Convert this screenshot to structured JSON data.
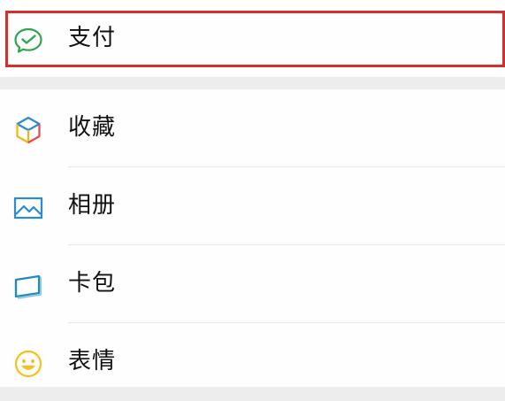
{
  "pay_section": {
    "item": {
      "label": "支付",
      "icon": "wechat-pay-icon"
    },
    "highlight_color": "#d32f2f"
  },
  "main_section": {
    "items": [
      {
        "label": "收藏",
        "icon": "favorites-cube-icon"
      },
      {
        "label": "相册",
        "icon": "album-picture-icon"
      },
      {
        "label": "卡包",
        "icon": "card-wallet-icon"
      },
      {
        "label": "表情",
        "icon": "smiley-emoji-icon"
      }
    ]
  },
  "colors": {
    "background": "#ededed",
    "row_background": "#fefefe",
    "pay_green": "#2ea54e",
    "album_blue": "#2b8ad6",
    "card_teal": "#1f8cbf",
    "emoji_yellow": "#f2c21b"
  }
}
